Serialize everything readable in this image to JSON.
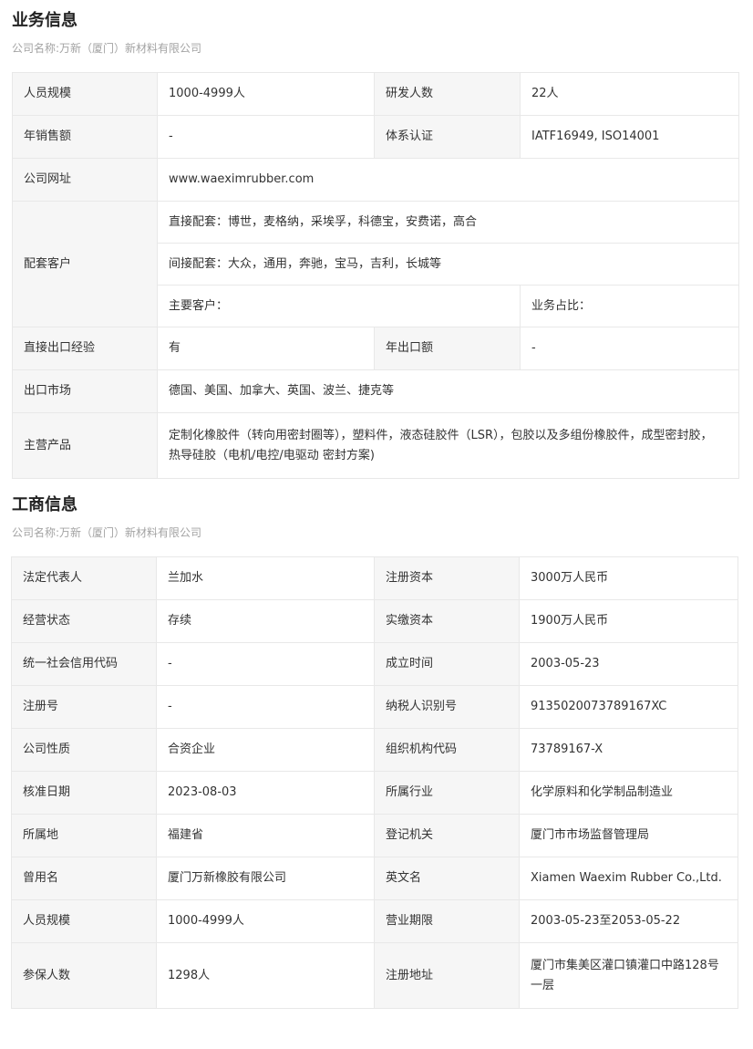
{
  "business": {
    "title": "业务信息",
    "company": "公司名称:万新（厦门）新材料有限公司",
    "staff_size_label": "人员规模",
    "staff_size": "1000-4999人",
    "rd_staff_label": "研发人数",
    "rd_staff": "22人",
    "annual_sales_label": "年销售额",
    "annual_sales": "-",
    "certification_label": "体系认证",
    "certification": "IATF16949, ISO14001",
    "website_label": "公司网址",
    "website": "www.waeximrubber.com",
    "customers_label": "配套客户",
    "direct_customers": "直接配套：博世，麦格纳，采埃孚，科德宝，安费诺，高合",
    "indirect_customers": "间接配套：大众，通用，奔驰，宝马，吉利，长城等",
    "main_customers": "主要客户：",
    "business_share": "业务占比：",
    "export_experience_label": "直接出口经验",
    "export_experience": "有",
    "annual_export_label": "年出口额",
    "annual_export": "-",
    "export_markets_label": "出口市场",
    "export_markets": "德国、美国、加拿大、英国、波兰、捷克等",
    "main_products_label": "主营产品",
    "main_products_line1": "定制化橡胶件（转向用密封圈等），塑料件，液态硅胶件（LSR），包胶以及多组份橡胶件，成型密封胶，",
    "main_products_line2": "热导硅胶（电机/电控/电驱动 密封方案)"
  },
  "registration": {
    "title": "工商信息",
    "company": "公司名称:万新（厦门）新材料有限公司",
    "rows": [
      {
        "l1": "法定代表人",
        "v1": "兰加水",
        "l2": "注册资本",
        "v2": "3000万人民币"
      },
      {
        "l1": "经营状态",
        "v1": "存续",
        "l2": "实缴资本",
        "v2": "1900万人民币"
      },
      {
        "l1": "统一社会信用代码",
        "v1": "-",
        "l2": "成立时间",
        "v2": "2003-05-23"
      },
      {
        "l1": "注册号",
        "v1": "-",
        "l2": "纳税人识别号",
        "v2": "9135020073789167XC"
      },
      {
        "l1": "公司性质",
        "v1": "合资企业",
        "l2": "组织机构代码",
        "v2": "73789167-X"
      },
      {
        "l1": "核准日期",
        "v1": "2023-08-03",
        "l2": "所属行业",
        "v2": "化学原料和化学制品制造业"
      },
      {
        "l1": "所属地",
        "v1": "福建省",
        "l2": "登记机关",
        "v2": "厦门市市场监督管理局"
      },
      {
        "l1": "曾用名",
        "v1": "厦门万新橡胶有限公司",
        "l2": "英文名",
        "v2": "Xiamen Waexim Rubber Co.,Ltd."
      },
      {
        "l1": "人员规模",
        "v1": "1000-4999人",
        "l2": "营业期限",
        "v2": "2003-05-23至2053-05-22"
      }
    ],
    "insured_label": "参保人数",
    "insured": "1298人",
    "address_label": "注册地址",
    "address_line1": "厦门市集美区灌口镇灌口中路128号",
    "address_line2": "一层"
  }
}
